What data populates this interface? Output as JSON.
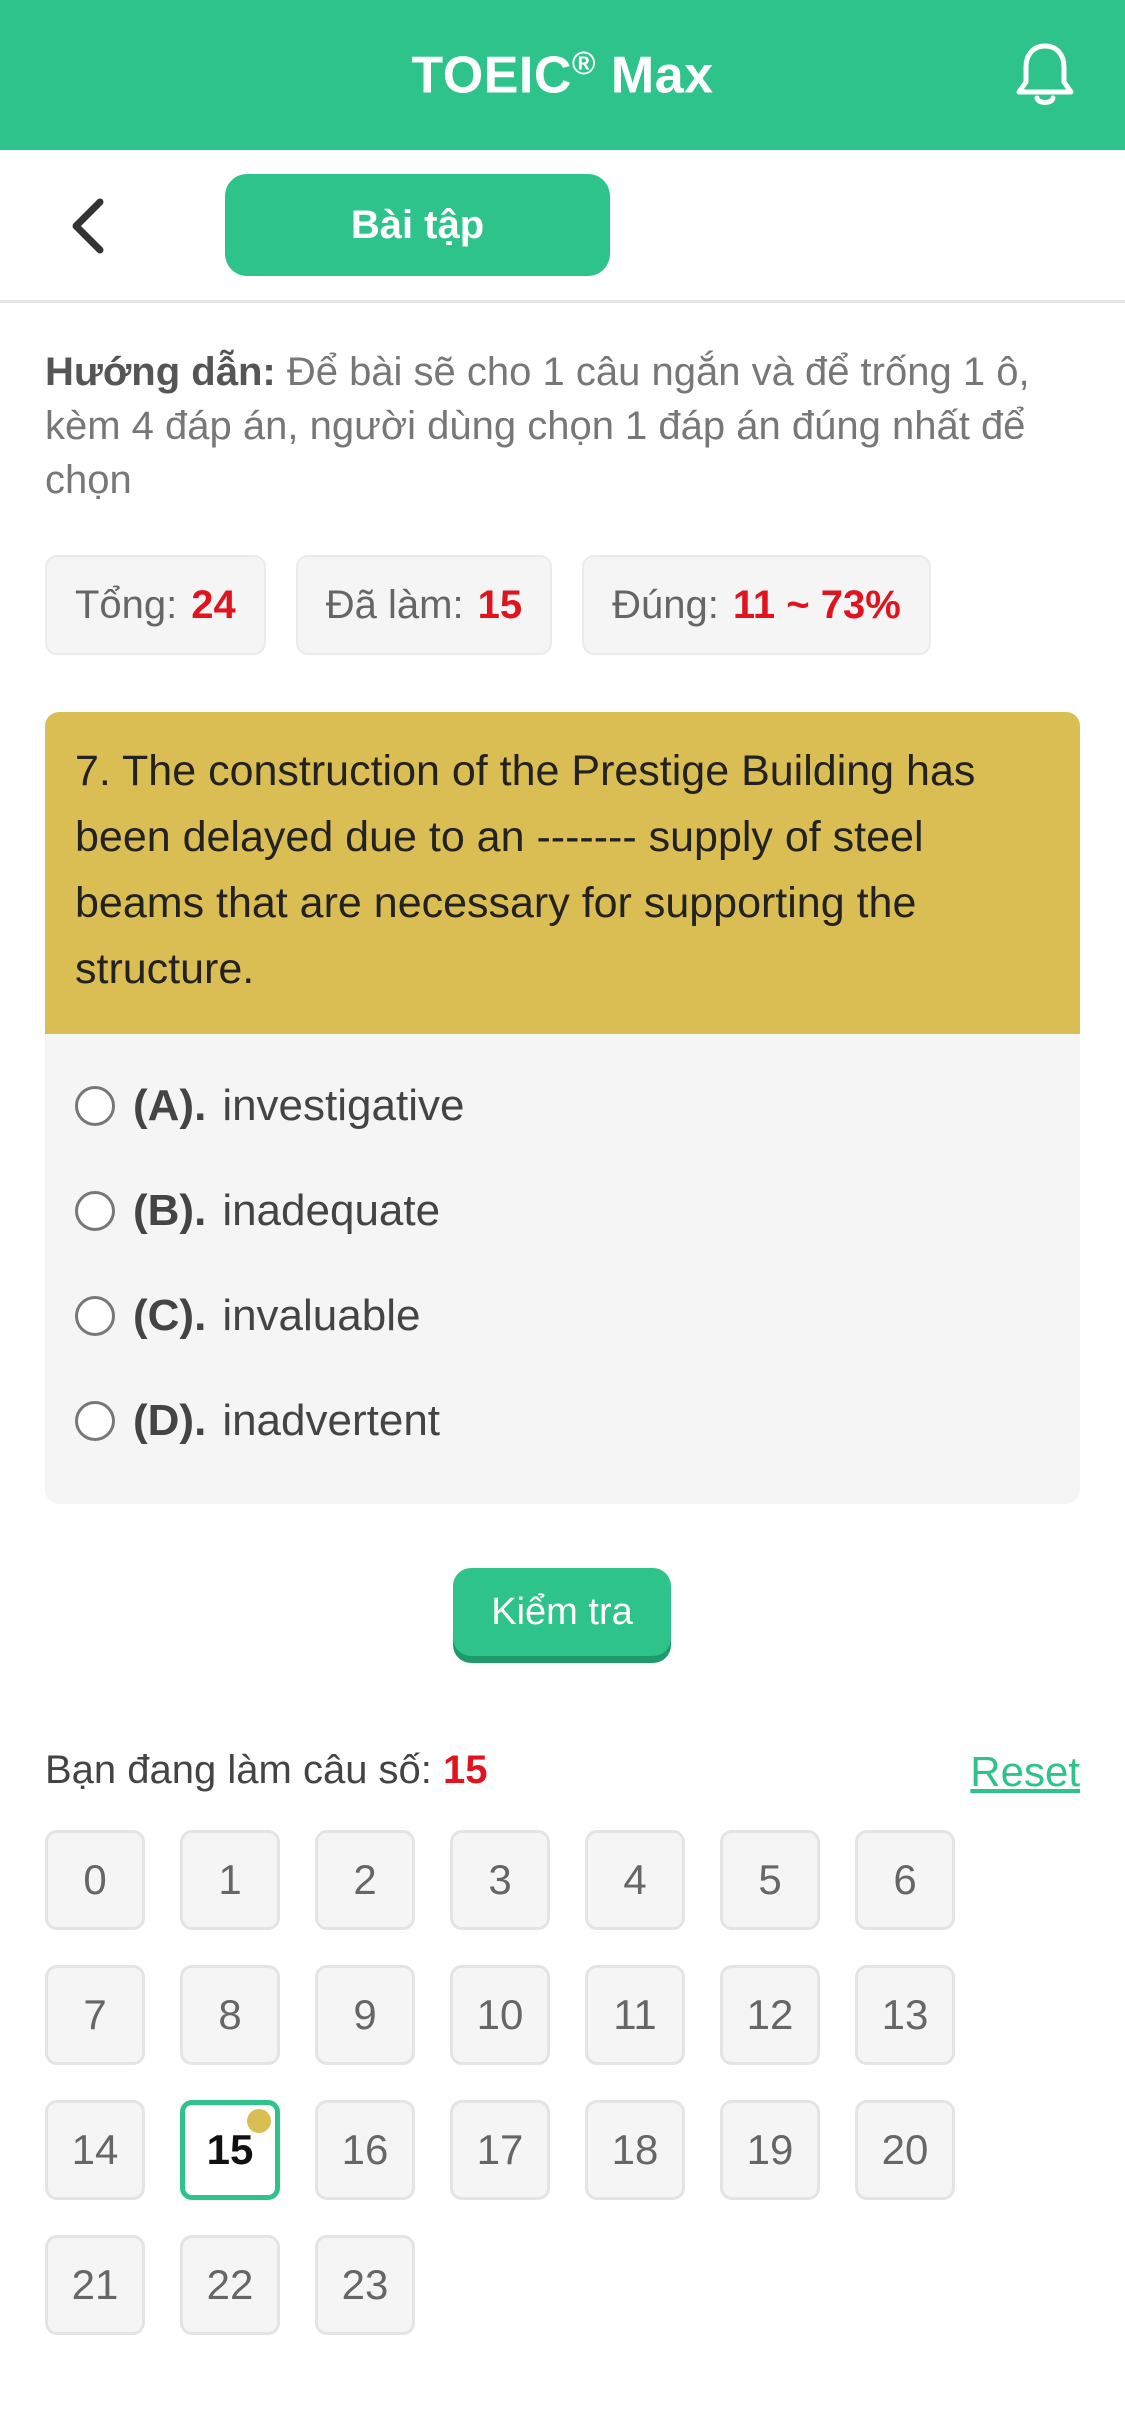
{
  "header": {
    "title": "TOEIC",
    "title_mark": "®",
    "title_suffix": " Max"
  },
  "subbar": {
    "tab_label": "Bài tập"
  },
  "guide": {
    "label": "Hướng dẫn:",
    "text": " Để bài sẽ cho 1 câu ngắn và để trống 1 ô, kèm 4 đáp án, người dùng chọn 1 đáp án đúng nhất để chọn"
  },
  "stats": [
    {
      "label": "Tổng:",
      "value": "24"
    },
    {
      "label": "Đã làm:",
      "value": "15"
    },
    {
      "label": "Đúng:",
      "value": "11 ~ 73%"
    }
  ],
  "question": {
    "text": "7. The construction of the Prestige Building has been delayed due to an ------- supply of steel beams that are necessary for supporting the structure.",
    "options": [
      {
        "key": "(A).",
        "text": "investigative"
      },
      {
        "key": "(B).",
        "text": "inadequate"
      },
      {
        "key": "(C).",
        "text": "invaluable"
      },
      {
        "key": "(D).",
        "text": "inadvertent"
      }
    ]
  },
  "check_button": "Kiểm tra",
  "progress": {
    "label": "Bạn đang làm câu số:",
    "current": "15",
    "reset_label": "Reset"
  },
  "grid": [
    "0",
    "1",
    "2",
    "3",
    "4",
    "5",
    "6",
    "7",
    "8",
    "9",
    "10",
    "11",
    "12",
    "13",
    "14",
    "15",
    "16",
    "17",
    "18",
    "19",
    "20",
    "21",
    "22",
    "23"
  ],
  "colors": {
    "primary": "#2dc38a",
    "question_bg": "#dbbe53",
    "highlight": "#e0141e"
  }
}
